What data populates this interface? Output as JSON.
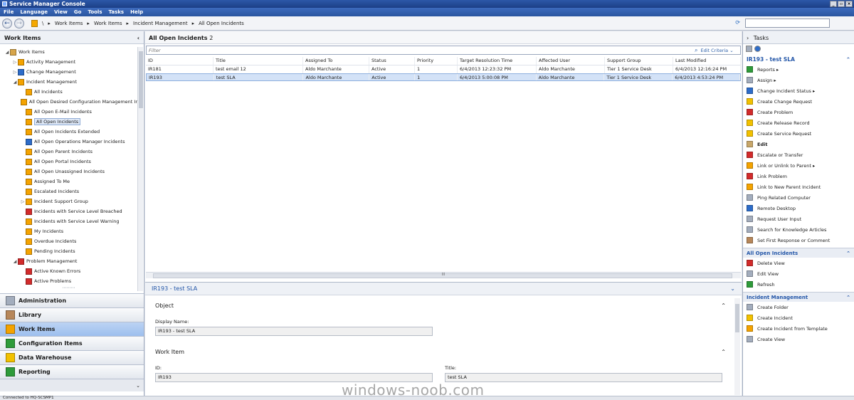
{
  "window": {
    "title": "Service Manager Console"
  },
  "menu": [
    "File",
    "Language",
    "View",
    "Go",
    "Tools",
    "Tasks",
    "Help"
  ],
  "breadcrumb": [
    "Work Items",
    "Work Items",
    "Incident Management",
    "All Open Incidents"
  ],
  "left": {
    "header": "Work Items",
    "tree": [
      {
        "label": "Work Items",
        "level": 0,
        "expander": "◢",
        "icon": "folder"
      },
      {
        "label": "Activity Management",
        "level": 1,
        "expander": "▷",
        "icon": "orange"
      },
      {
        "label": "Change Management",
        "level": 1,
        "expander": "▷",
        "icon": "blue"
      },
      {
        "label": "Incident Management",
        "level": 1,
        "expander": "◢",
        "icon": "orange"
      },
      {
        "label": "All Incidents",
        "level": 2,
        "icon": "orange"
      },
      {
        "label": "All Open Desired Configuration Management Ir",
        "level": 2,
        "icon": "orange"
      },
      {
        "label": "All Open E-Mail Incidents",
        "level": 2,
        "icon": "orange"
      },
      {
        "label": "All Open Incidents",
        "level": 2,
        "icon": "orange",
        "selected": true
      },
      {
        "label": "All Open Incidents Extended",
        "level": 2,
        "icon": "orange"
      },
      {
        "label": "All Open Operations Manager Incidents",
        "level": 2,
        "icon": "blue"
      },
      {
        "label": "All Open Parent Incidents",
        "level": 2,
        "icon": "orange"
      },
      {
        "label": "All Open Portal Incidents",
        "level": 2,
        "icon": "orange"
      },
      {
        "label": "All Open Unassigned Incidents",
        "level": 2,
        "icon": "orange"
      },
      {
        "label": "Assigned To Me",
        "level": 2,
        "icon": "orange"
      },
      {
        "label": "Escalated Incidents",
        "level": 2,
        "icon": "orange"
      },
      {
        "label": "Incident Support Group",
        "level": 2,
        "expander": "▷",
        "icon": "orange"
      },
      {
        "label": "Incidents with Service Level Breached",
        "level": 2,
        "icon": "red"
      },
      {
        "label": "Incidents with Service Level Warning",
        "level": 2,
        "icon": "orange"
      },
      {
        "label": "My Incidents",
        "level": 2,
        "icon": "orange"
      },
      {
        "label": "Overdue Incidents",
        "level": 2,
        "icon": "orange"
      },
      {
        "label": "Pending Incidents",
        "level": 2,
        "icon": "orange"
      },
      {
        "label": "Problem Management",
        "level": 1,
        "expander": "◢",
        "icon": "red"
      },
      {
        "label": "Active Known Errors",
        "level": 2,
        "icon": "red"
      },
      {
        "label": "Active Problems",
        "level": 2,
        "icon": "red"
      }
    ],
    "wunderbar": [
      {
        "label": "Administration",
        "icon": "gray"
      },
      {
        "label": "Library",
        "icon": "brown"
      },
      {
        "label": "Work Items",
        "icon": "orange",
        "selected": true
      },
      {
        "label": "Configuration Items",
        "icon": "green"
      },
      {
        "label": "Data Warehouse",
        "icon": "yellow"
      },
      {
        "label": "Reporting",
        "icon": "green"
      }
    ]
  },
  "list": {
    "title": "All Open Incidents",
    "count": "2",
    "filter_placeholder": "Filter",
    "edit_criteria": "Edit Criteria",
    "columns": [
      "ID",
      "Title",
      "Assigned To",
      "Status",
      "Priority",
      "Target Resolution Time",
      "Affected User",
      "Support Group",
      "Last Modified"
    ],
    "rows": [
      [
        "IR181",
        "test email 12",
        "Aldo Marchante",
        "Active",
        "1",
        "6/4/2013 12:23:32 PM",
        "Aldo Marchante",
        "Tier 1 Service Desk",
        "6/4/2013 12:16:24 PM"
      ],
      [
        "IR193",
        "test SLA",
        "Aldo Marchante",
        "Active",
        "1",
        "6/4/2013 5:00:08 PM",
        "Aldo Marchante",
        "Tier 1 Service Desk",
        "6/4/2013 4:53:24 PM"
      ]
    ],
    "selected_row": 1
  },
  "details": {
    "title": "IR193 - test SLA",
    "object_section": "Object",
    "display_name_label": "Display Name:",
    "display_name_value": "IR193 - test SLA",
    "workitem_section": "Work Item",
    "id_label": "ID:",
    "id_value": "IR193",
    "title_label": "Title:",
    "title_value": "test SLA"
  },
  "tasks": {
    "header": "Tasks",
    "sections": [
      {
        "title": "IR193 - test SLA",
        "items": [
          {
            "label": "Reports ▸",
            "icon": "green"
          },
          {
            "label": "Assign ▸",
            "icon": "gray"
          },
          {
            "label": "Change Incident Status ▸",
            "icon": "blue"
          },
          {
            "label": "Create Change Request",
            "icon": "yellow"
          },
          {
            "label": "Create Problem",
            "icon": "red"
          },
          {
            "label": "Create Release Record",
            "icon": "yellow"
          },
          {
            "label": "Create Service Request",
            "icon": "yellow"
          },
          {
            "label": "Edit",
            "icon": "pencil",
            "bold": true
          },
          {
            "label": "Escalate or Transfer",
            "icon": "red"
          },
          {
            "label": "Link or Unlink to Parent ▸",
            "icon": "orange"
          },
          {
            "label": "Link Problem",
            "icon": "red"
          },
          {
            "label": "Link to New Parent Incident",
            "icon": "orange"
          },
          {
            "label": "Ping Related Computer",
            "icon": "gray"
          },
          {
            "label": "Remote Desktop",
            "icon": "blue"
          },
          {
            "label": "Request User Input",
            "icon": "gray"
          },
          {
            "label": "Search for Knowledge Articles",
            "icon": "gray"
          },
          {
            "label": "Set First Response or Comment",
            "icon": "brown"
          }
        ]
      },
      {
        "title": "All Open Incidents",
        "items": [
          {
            "label": "Delete View",
            "icon": "red"
          },
          {
            "label": "Edit View",
            "icon": "gray"
          },
          {
            "label": "Refresh",
            "icon": "green"
          }
        ]
      },
      {
        "title": "Incident Management",
        "items": [
          {
            "label": "Create Folder",
            "icon": "gray"
          },
          {
            "label": "Create Incident",
            "icon": "yellow"
          },
          {
            "label": "Create Incident from Template",
            "icon": "orange"
          },
          {
            "label": "Create View",
            "icon": "gray"
          }
        ]
      }
    ]
  },
  "status": "Connected to HQ-SCSMP1",
  "watermark": "windows-noob.com"
}
